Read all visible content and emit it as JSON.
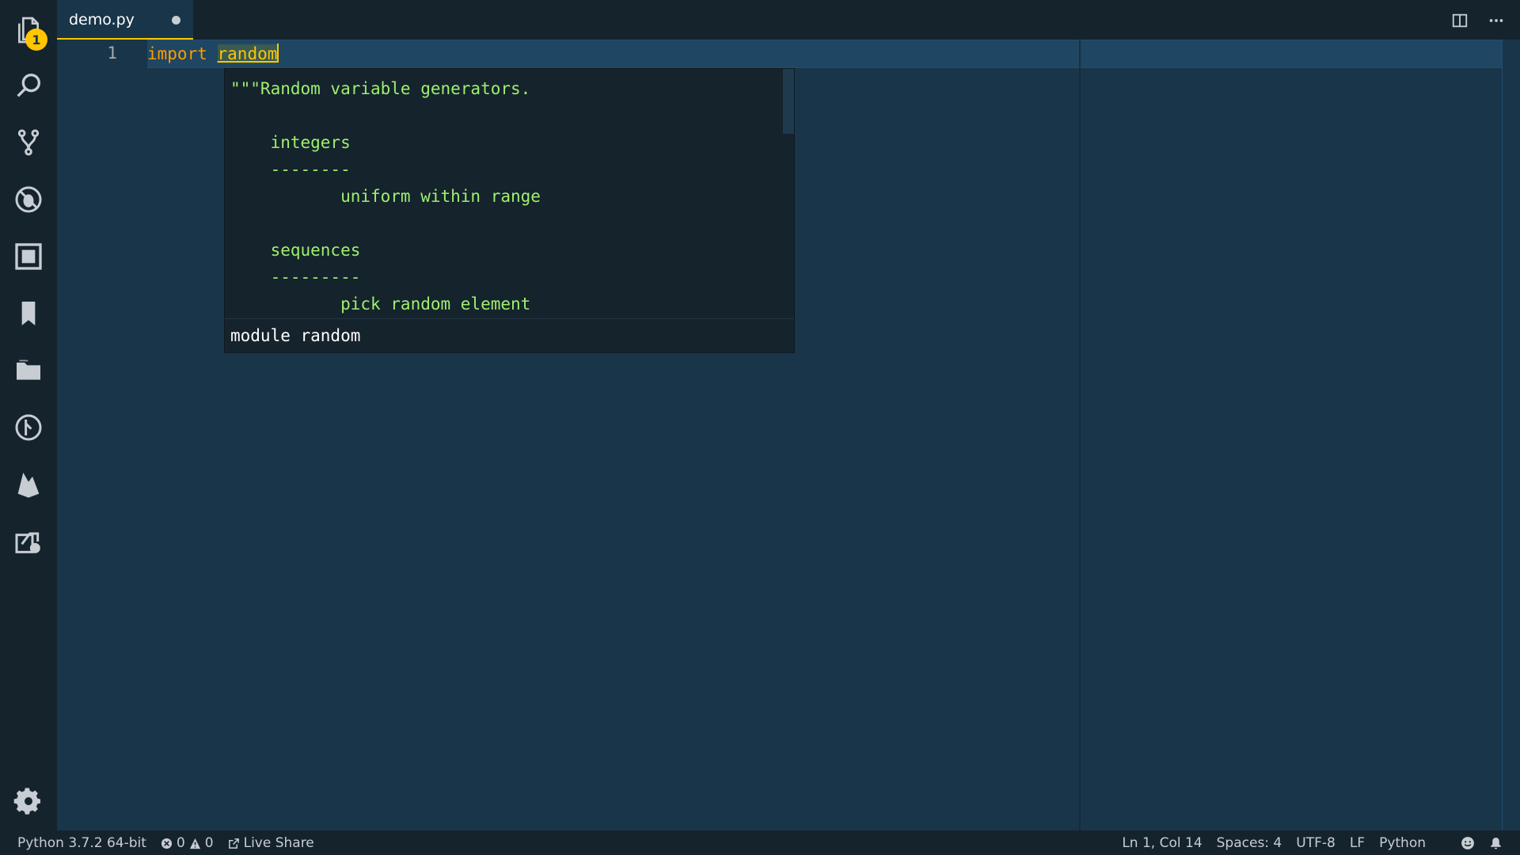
{
  "tab": {
    "filename": "demo.py"
  },
  "activity": {
    "explorer_badge": "1"
  },
  "editor": {
    "line_number": "1",
    "keyword": "import",
    "module": "random"
  },
  "hover": {
    "doc_lines": [
      "\"\"\"Random variable generators.",
      "",
      "    integers",
      "    --------",
      "           uniform within range",
      "",
      "    sequences",
      "    ---------",
      "           pick random element"
    ],
    "signature": "module random"
  },
  "status": {
    "interpreter": "Python 3.7.2 64-bit",
    "errors": "0",
    "warnings": "0",
    "live_share": "Live Share",
    "cursor_pos": "Ln 1, Col 14",
    "spaces": "Spaces: 4",
    "encoding": "UTF-8",
    "eol": "LF",
    "language": "Python"
  },
  "colors": {
    "accent": "#ffc600",
    "background": "#193549",
    "panel": "#15232d",
    "keyword": "#ff9d00",
    "doc_text": "#9ef06d"
  }
}
